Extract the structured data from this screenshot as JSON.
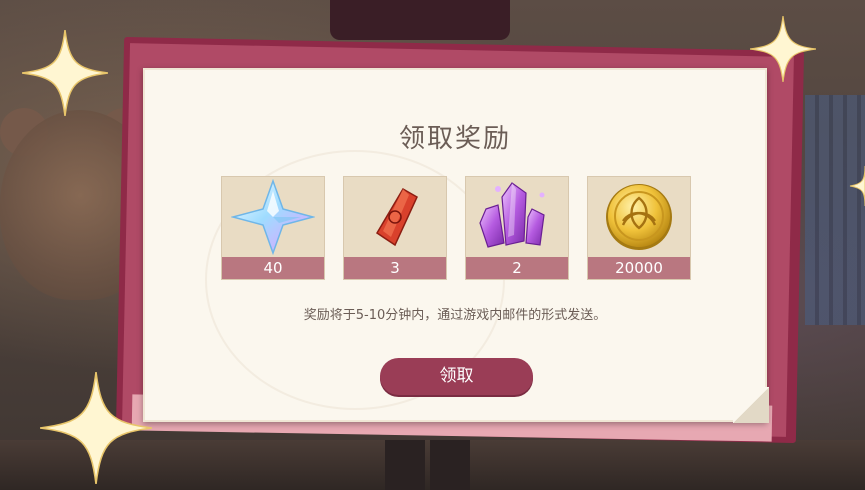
{
  "dialog": {
    "title": "领取奖励",
    "notice": "奖励将于5-10分钟内，通过游戏内邮件的形式发送。",
    "claim_label": "领取"
  },
  "rewards": [
    {
      "icon": "primogem-icon",
      "count": "40"
    },
    {
      "icon": "red-crystal-icon",
      "count": "3"
    },
    {
      "icon": "purple-crystal-cluster-icon",
      "count": "2"
    },
    {
      "icon": "gold-coin-icon",
      "count": "20000"
    }
  ],
  "colors": {
    "frame": "#8f2a48",
    "panel": "#fbf7ee",
    "card_bg": "#e9dcc4",
    "count_bar": "#b97780",
    "button": "#9a3d56",
    "text": "#6b5d56"
  }
}
